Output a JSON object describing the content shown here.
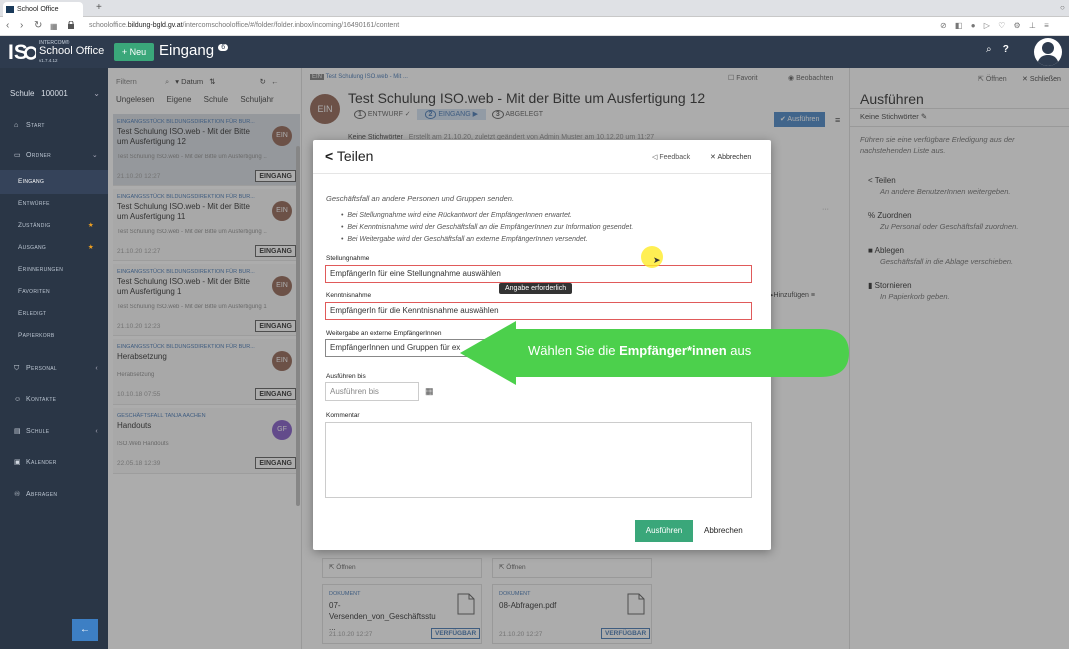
{
  "browser": {
    "tab_title": "School Office",
    "new_tab": "+",
    "url_prefix": "schooloffice.",
    "url_domain": "bildung-bgld.gv.at",
    "url_path": "/intercomschooloffice/#/folder/folder.inbox/incoming/16490161/content"
  },
  "app": {
    "brand_small": "INTERCOM®",
    "brand": "School Office",
    "version": "v1.7.4.12",
    "new_button": "+ Neu",
    "title": "Eingang",
    "title_badge": "6"
  },
  "sidebar": {
    "school_label": "Schule",
    "school_value": "100001",
    "items": [
      {
        "label": "Start",
        "icon": "home-icon"
      },
      {
        "label": "Ordner",
        "icon": "folder-icon"
      },
      {
        "label": "Eingang"
      },
      {
        "label": "Entwürfe"
      },
      {
        "label": "Zuständig"
      },
      {
        "label": "Ausgang"
      },
      {
        "label": "Erinnerungen"
      },
      {
        "label": "Favoriten"
      },
      {
        "label": "Erledigt"
      },
      {
        "label": "Papierkorb"
      },
      {
        "label": "Personal",
        "icon": "graduation-icon"
      },
      {
        "label": "Kontakte",
        "icon": "people-icon"
      },
      {
        "label": "Schule",
        "icon": "building-icon"
      },
      {
        "label": "Kalender",
        "icon": "calendar-icon"
      },
      {
        "label": "Abfragen",
        "icon": "binoculars-icon"
      }
    ]
  },
  "list": {
    "filter_placeholder": "Filtern",
    "sort_label": "Datum",
    "filters": [
      "Ungelesen",
      "Eigene",
      "Schule",
      "Schuljahr"
    ],
    "cards": [
      {
        "cat": "Eingangsstück Bildungsdirektion für Bur...",
        "title": "Test Schulung ISO.web - Mit der Bitte um Ausfertigung 12",
        "sub": "Test Schulung ISO.web - Mit der Bitte um Ausfertigung ...",
        "date": "21.10.20 12:27",
        "status": "EINGANG",
        "avatar": "EIN"
      },
      {
        "cat": "Eingangsstück Bildungsdirektion für Bur...",
        "title": "Test Schulung ISO.web - Mit der Bitte um Ausfertigung 11",
        "sub": "Test Schulung ISO.web - Mit der Bitte um Ausfertigung ...",
        "date": "21.10.20 12:27",
        "status": "EINGANG",
        "avatar": "EIN"
      },
      {
        "cat": "Eingangsstück Bildungsdirektion für Bur...",
        "title": "Test Schulung ISO.web - Mit der Bitte um Ausfertigung 1",
        "sub": "Test Schulung ISO.web - Mit der Bitte um Ausfertigung 1",
        "date": "21.10.20 12:23",
        "status": "EINGANG",
        "avatar": "EIN"
      },
      {
        "cat": "Eingangsstück Bildungsdirektion für Bur...",
        "title": "Herabsetzung",
        "sub": "Herabsetzung",
        "date": "10.10.18 07:55",
        "status": "EINGANG",
        "avatar": "EIN"
      },
      {
        "cat": "Geschäftsfall Tanja Aachen",
        "title": "Handouts",
        "sub": "ISO.Web Handouts",
        "date": "22.05.18 12:39",
        "status": "EINGANG",
        "avatar": "GF"
      }
    ]
  },
  "main": {
    "badge": "EIN",
    "crumb": "Test Schulung ISO.web - Mit ...",
    "favorite": "Favorit",
    "watch": "Beobachten",
    "title": "Test Schulung ISO.web - Mit der Bitte um Ausfertigung 12",
    "avatar": "EIN",
    "steps": [
      {
        "num": "1",
        "label": "ENTWURF ✓"
      },
      {
        "num": "2",
        "label": "EINGANG ▶"
      },
      {
        "num": "3",
        "label": "ABGELEGT"
      }
    ],
    "execute_button": "✔ Ausführen",
    "keywords_partial": "Keine Stichwörter",
    "created_partial": "Erstellt am 21.10.20, zuletzt geändert von Admin Muster am 10.12.20 um 11:27",
    "add_label": "Hinzufügen",
    "docs": [
      {
        "open": "Öffnen",
        "type": "DOKUMENT",
        "name": "07-Versenden_von_Geschäftsstu ...",
        "date": "21.10.20 12:27",
        "status": "VERFÜGBAR"
      },
      {
        "open": "Öffnen",
        "type": "DOKUMENT",
        "name": "08-Abfragen.pdf",
        "date": "21.10.20 12:27",
        "status": "VERFÜGBAR"
      }
    ]
  },
  "right": {
    "open": "Öffnen",
    "close": "Schließen",
    "title": "Ausführen",
    "keywords": "Keine Stichwörter",
    "intro": "Führen sie eine verfügbare Erledigung aus der nachstehenden Liste aus.",
    "actions": [
      {
        "name": "Teilen",
        "desc": "An andere BenutzerInnen weitergeben.",
        "icon": "share-icon"
      },
      {
        "name": "Zuordnen",
        "desc": "Zu Personal oder Geschäftsfall zuordnen.",
        "icon": "link-icon"
      },
      {
        "name": "Ablegen",
        "desc": "Geschäftsfall in die Ablage verschieben.",
        "icon": "archive-icon"
      },
      {
        "name": "Stornieren",
        "desc": "In Papierkorb geben.",
        "icon": "trash-icon"
      }
    ]
  },
  "modal": {
    "title": "Teilen",
    "feedback": "Feedback",
    "cancel_top": "Abbrechen",
    "intro": "Geschäftsfall an andere Personen und Gruppen senden.",
    "bullets": [
      "Bei Stellungnahme wird eine Rückantwort der EmpfängerInnen erwartet.",
      "Bei Kenntnisnahme wird der Geschäftsfall an die EmpfängerInnen zur Information gesendet.",
      "Bei Weitergabe wird der Geschäftsfall an externe EmpfängerInnen versendet."
    ],
    "label_statement": "Stellungnahme",
    "ph_statement": "EmpfängerIn für eine Stellungnahme auswählen",
    "label_notice": "Kenntnisnahme",
    "ph_notice": "EmpfängerIn für die Kenntnisnahme auswählen",
    "label_external": "Weitergabe an externe EmpfängerInnen",
    "ph_external": "EmpfängerInnen und Gruppen für ex",
    "label_due": "Ausführen bis",
    "ph_due": "Ausführen bis",
    "label_comment": "Kommentar",
    "submit": "Ausführen",
    "cancel": "Abbrechen",
    "tooltip": "Angabe erforderlich"
  },
  "callout": {
    "text_pre": "Wählen Sie die ",
    "text_bold": "Empfänger*innen",
    "text_post": " aus"
  },
  "colors": {
    "header": "#2e3b4e",
    "sidebar": "#2a3646",
    "accent_green": "#3aa77a",
    "callout_green": "#4cd04c",
    "required_red": "#e05a5a",
    "link_blue": "#3a6fb0"
  }
}
